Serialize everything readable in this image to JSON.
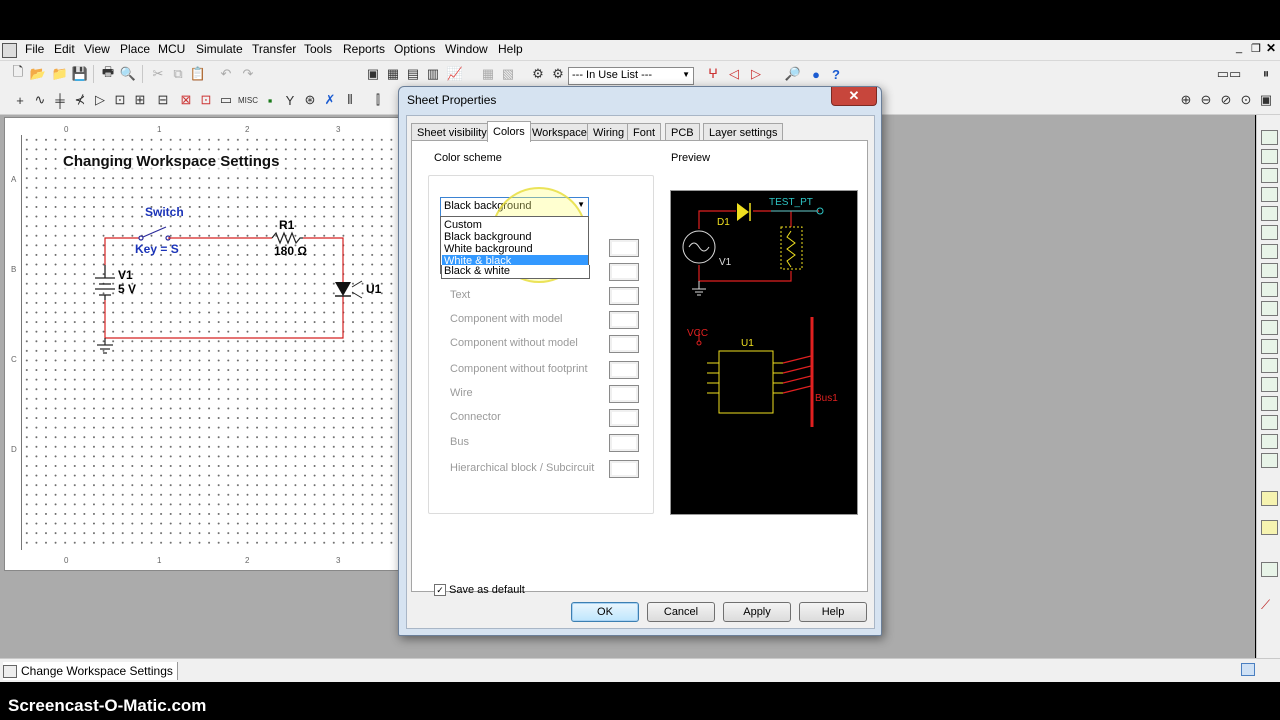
{
  "menu": {
    "items": [
      "File",
      "Edit",
      "View",
      "Place",
      "MCU",
      "Simulate",
      "Transfer",
      "Tools",
      "Reports",
      "Options",
      "Window",
      "Help"
    ]
  },
  "toolbar": {
    "in_use_list": "--- In Use List ---"
  },
  "sheet": {
    "title": "Changing Workspace Settings",
    "switch_label": "Switch",
    "switch_key": "Key = S",
    "r1_name": "R1",
    "r1_value": "180 Ω",
    "v1_name": "V1",
    "v1_value": "5 V",
    "u1_name": "U1",
    "ruler_top": [
      "0",
      "1",
      "2",
      "3"
    ],
    "ruler_left": [
      "A",
      "B",
      "C",
      "D"
    ]
  },
  "dialog": {
    "title": "Sheet Properties",
    "tabs": [
      "Sheet visibility",
      "Colors",
      "Workspace",
      "Wiring",
      "Font",
      "PCB",
      "Layer settings"
    ],
    "active_tab": "Colors",
    "color_scheme_label": "Color scheme",
    "selected_scheme": "Black background",
    "dropdown_options": [
      "Custom",
      "Black background",
      "White background",
      "White & black",
      "Black & white"
    ],
    "highlighted_option": "White & black",
    "color_labels": [
      "Text",
      "Component with model",
      "Component without model",
      "Component without footprint",
      "Wire",
      "Connector",
      "Bus",
      "Hierarchical block / Subcircuit"
    ],
    "preview_label": "Preview",
    "preview": {
      "test_pt": "TEST_PT",
      "d1": "D1",
      "v1": "V1",
      "vcc": "VCC",
      "u1": "U1",
      "bus1": "Bus1"
    },
    "save_default_label": "Save as default",
    "save_default_checked": true,
    "buttons": [
      "OK",
      "Cancel",
      "Apply",
      "Help"
    ]
  },
  "statusbar": {
    "tab_label": "Change Workspace Settings"
  },
  "watermark": "Screencast-O-Matic.com"
}
